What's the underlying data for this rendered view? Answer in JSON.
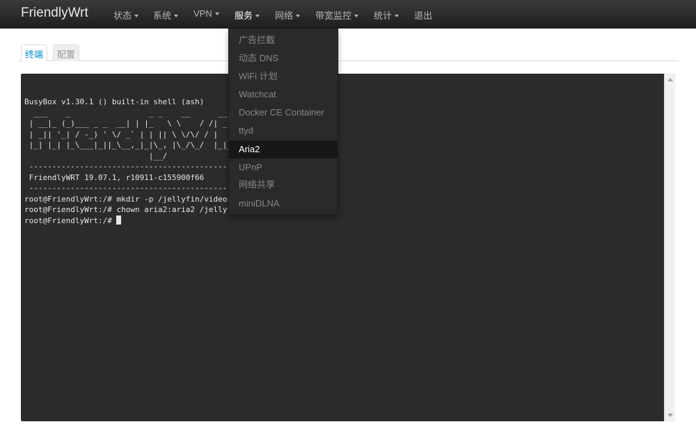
{
  "navbar": {
    "brand": "FriendlyWrt",
    "items": [
      {
        "label": "状态"
      },
      {
        "label": "系统"
      },
      {
        "label": "VPN"
      },
      {
        "label": "服务"
      },
      {
        "label": "网络"
      },
      {
        "label": "带宽监控"
      },
      {
        "label": "统计"
      },
      {
        "label": "退出"
      }
    ]
  },
  "tabs": [
    {
      "label": "终端",
      "active": true
    },
    {
      "label": "配置",
      "active": false
    }
  ],
  "dropdown": {
    "parent": "服务",
    "items": [
      {
        "label": "广告拦截"
      },
      {
        "label": "动态 DNS"
      },
      {
        "label": "WiFi 计划"
      },
      {
        "label": "Watchcat"
      },
      {
        "label": "Docker CE Container"
      },
      {
        "label": "ttyd"
      },
      {
        "label": "Aria2",
        "selected": true
      },
      {
        "label": "UPnP"
      },
      {
        "label": "网络共享"
      },
      {
        "label": "miniDLNA"
      }
    ]
  },
  "terminal": {
    "lines": [
      "",
      "BusyBox v1.30.1 () built-in shell (ash)",
      "",
      "  ___    _                 _ _    __      __ ___ _____",
      " | __|_ (_)___ _ _  __| | |_   \\ \\    / /| _ \\_   _|",
      " | _|| '_| / -_) ' \\/ _` | | || \\ \\/\\/ / |   / | |",
      " |_| |_| |_\\___|_||_\\__,_|_|\\_, |\\_/\\_/  |_|_\\ |_|",
      "                           |__/",
      " -----------------------------------------------------",
      " FriendlyWRT 19.07.1, r10911-c155900f66",
      " -----------------------------------------------------",
      "root@FriendlyWrt:/# mkdir -p /jellyfin/videos/Disk/download",
      "root@FriendlyWrt:/# chown aria2:aria2 /jellyfin/videos/Disk/download"
    ],
    "prompt": "root@FriendlyWrt:/# "
  },
  "colors": {
    "navbar_bg": "#2c2c2c",
    "terminal_bg": "#2b2b2b",
    "tab_active_text": "#0088cc",
    "dropdown_bg": "#2a2a2a"
  }
}
